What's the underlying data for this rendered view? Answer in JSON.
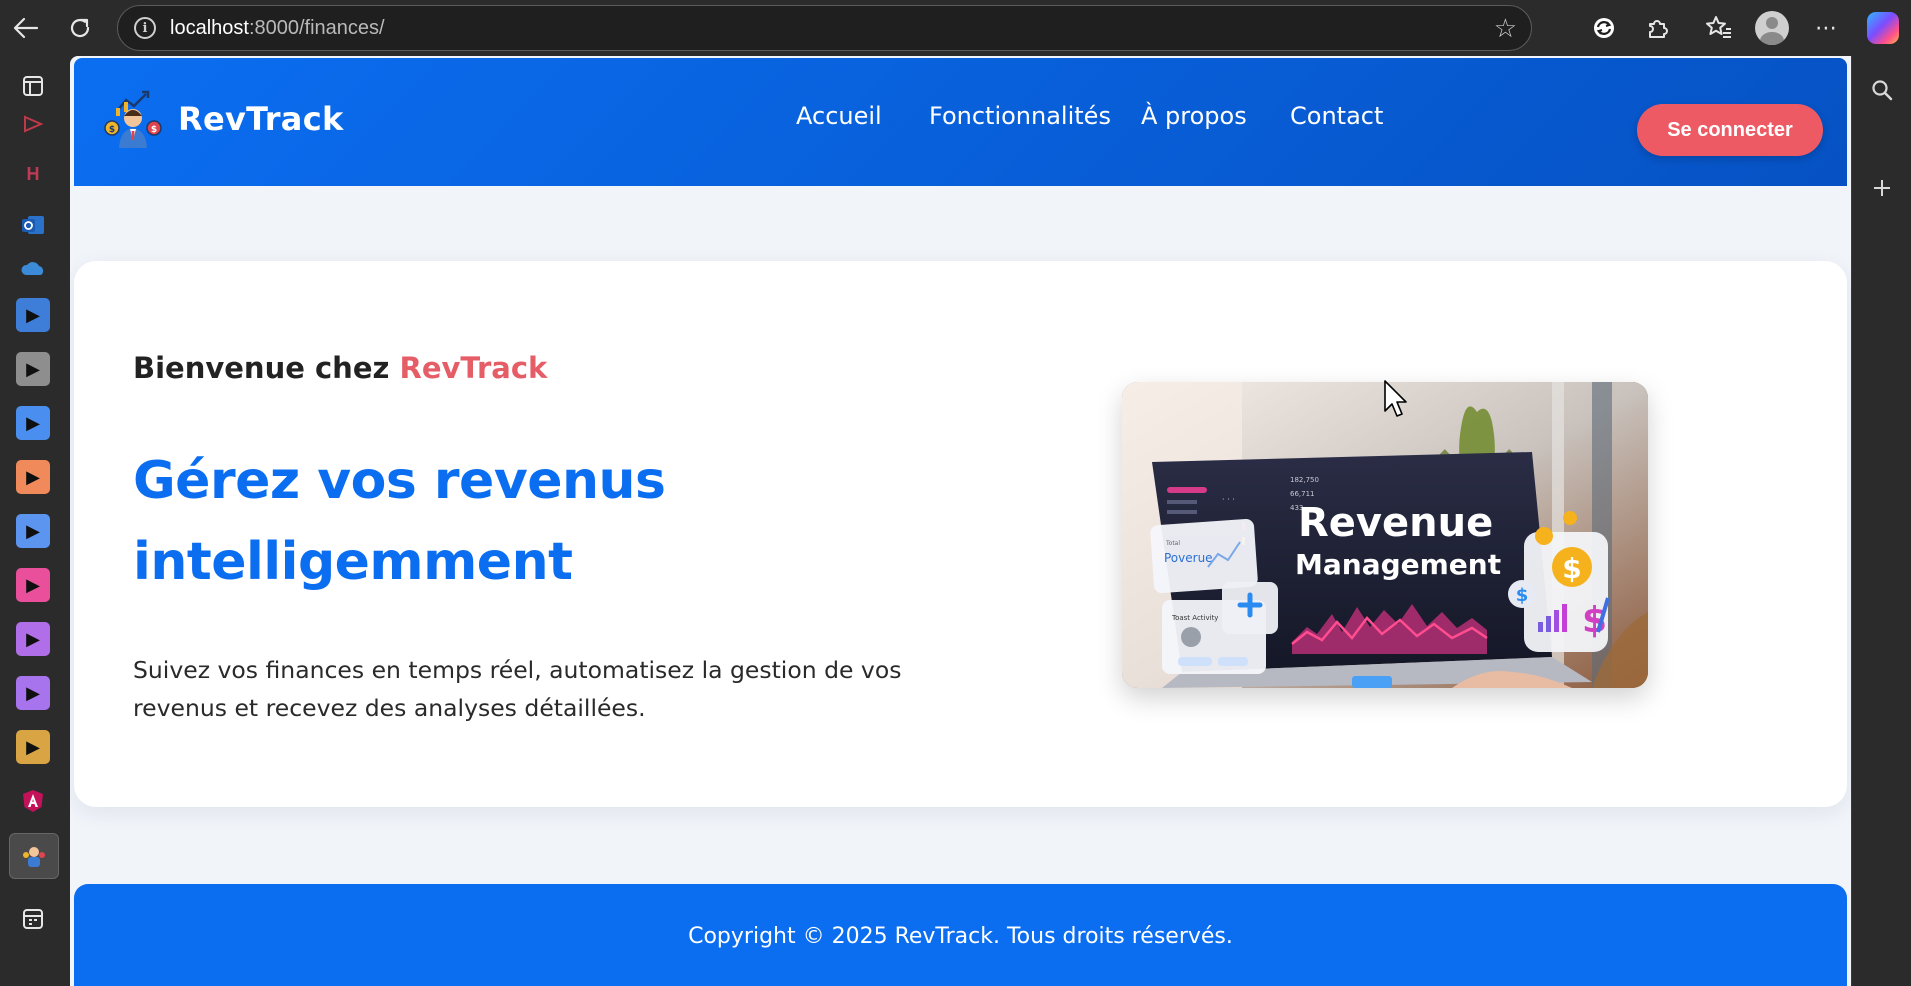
{
  "browser": {
    "url_host": "localhost",
    "url_path": ":8000/finances/"
  },
  "vertical_tabs": {
    "letter_tab": "H"
  },
  "site": {
    "brand": "RevTrack",
    "nav": {
      "home": "Accueil",
      "features": "Fonctionnalités",
      "about": "À propos",
      "contact": "Contact"
    },
    "login_label": "Se connecter",
    "accent_color": "#e55d66",
    "primary_color": "#0b6ef1"
  },
  "hero": {
    "welcome_prefix": "Bienvenue chez",
    "welcome_brand": "RevTrack",
    "headline": "Gérez vos revenus intelligemment",
    "lead": "Suivez vos finances en temps réel, automatisez la gestion de vos revenus et recevez des analyses détaillées.",
    "image": {
      "title": "Revenue",
      "subtitle": "Management",
      "card_label": "Poverue",
      "card_small": "Total",
      "card_activity": "Toast Activity"
    }
  },
  "footer": {
    "copyright": "Copyright © 2025 RevTrack. Tous droits réservés."
  }
}
